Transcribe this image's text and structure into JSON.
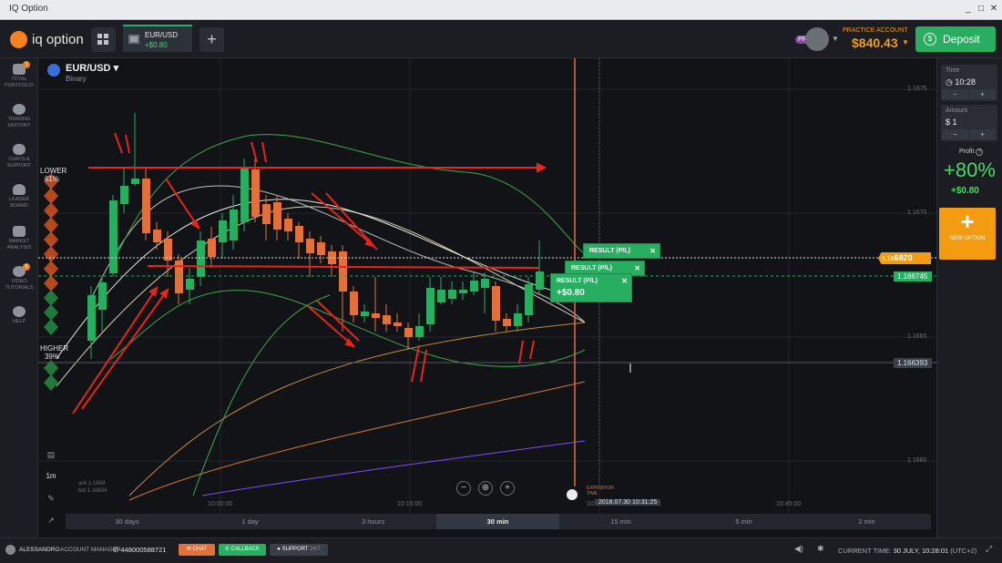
{
  "window": {
    "title": "IQ Option",
    "controls": [
      "_",
      "□",
      "✕"
    ]
  },
  "topbar": {
    "logo_text": "iq option",
    "asset_tab": {
      "symbol": "EUR/USD",
      "pl": "+$0.80"
    },
    "add_tab": "+",
    "account": {
      "badge": "PRO",
      "label": "PRACTICE ACCOUNT",
      "balance": "$840.43"
    },
    "deposit_label": "Deposit",
    "deposit_icon": "$"
  },
  "sidebar": {
    "items": [
      {
        "label": "TOTAL PORTFOLIO",
        "icon": "briefcase-icon",
        "badge": "1"
      },
      {
        "label": "TRADING HISTORY",
        "icon": "history-icon"
      },
      {
        "label": "CHATS & SUPPORT",
        "icon": "chat-icon"
      },
      {
        "label": "LEADER BOARD",
        "icon": "leaderboard-icon"
      },
      {
        "label": "MARKET ANALYSIS",
        "icon": "newspaper-icon"
      },
      {
        "label": "VIDEO TUTORIALS",
        "icon": "play-icon",
        "badge": "8"
      },
      {
        "label": "HELP",
        "icon": "help-icon"
      }
    ]
  },
  "chart": {
    "asset": "EUR/USD",
    "asset_type": "Binary",
    "lower": {
      "label": "LOWER",
      "pct": "61%"
    },
    "higher": {
      "label": "HIGHER",
      "pct": "39%"
    },
    "ask": "ask 1.1669",
    "bid": "bid 1.16634",
    "price_levels": [
      "1.1675",
      "1.1670",
      "1.1665",
      "1.1660"
    ],
    "time_labels": [
      "10:00:00",
      "10:15:00",
      "10:",
      "10:45:00"
    ],
    "current_price_prefix": "1.16",
    "current_price_suffix": "6820",
    "open_price": "1.166745",
    "cursor_price": "1.166393",
    "cursor_time": "2018.07.30 10:31:25",
    "expiration_label": "EXPIRATION TIME",
    "results": [
      {
        "label": "RESULT (P/L)"
      },
      {
        "label": "RESULT (P/L)"
      },
      {
        "label": "RESULT (P/L)",
        "value": "+$0.80"
      }
    ],
    "timeframe": "1m",
    "zoom": [
      "−",
      "⊕",
      "+"
    ]
  },
  "right_panel": {
    "time": {
      "label": "Time",
      "value": "10:28"
    },
    "amount": {
      "label": "Amount",
      "value": "$ 1"
    },
    "stepper_minus": "−",
    "stepper_plus": "+",
    "profit_label": "Profit",
    "profit_help": "?",
    "profit_pct": "+80%",
    "profit_amount": "+$0.80",
    "new_option": {
      "icon": "+",
      "label": "NEW OPTION"
    }
  },
  "periods": [
    {
      "label": "30 days",
      "active": false
    },
    {
      "label": "1 day",
      "active": false
    },
    {
      "label": "3 hours",
      "active": false
    },
    {
      "label": "30 min",
      "active": true
    },
    {
      "label": "15 min",
      "active": false
    },
    {
      "label": "5 min",
      "active": false
    },
    {
      "label": "2 min",
      "active": false
    }
  ],
  "bottombar": {
    "user": "ALESSANDRO",
    "manager_label": "ACCOUNT MANAGER",
    "phone": "448000588721",
    "chat": "CHAT",
    "callback": "CALLBACK",
    "support": "SUPPORT",
    "support_hours": "24/7",
    "current_time_label": "CURRENT TIME:",
    "current_time": "30 JULY, 10:28:01",
    "timezone": "(UTC+2)"
  },
  "colors": {
    "up": "#27ae60",
    "down": "#e2703a",
    "accent_orange": "#f39c12",
    "arrow_red": "#e8251c"
  }
}
